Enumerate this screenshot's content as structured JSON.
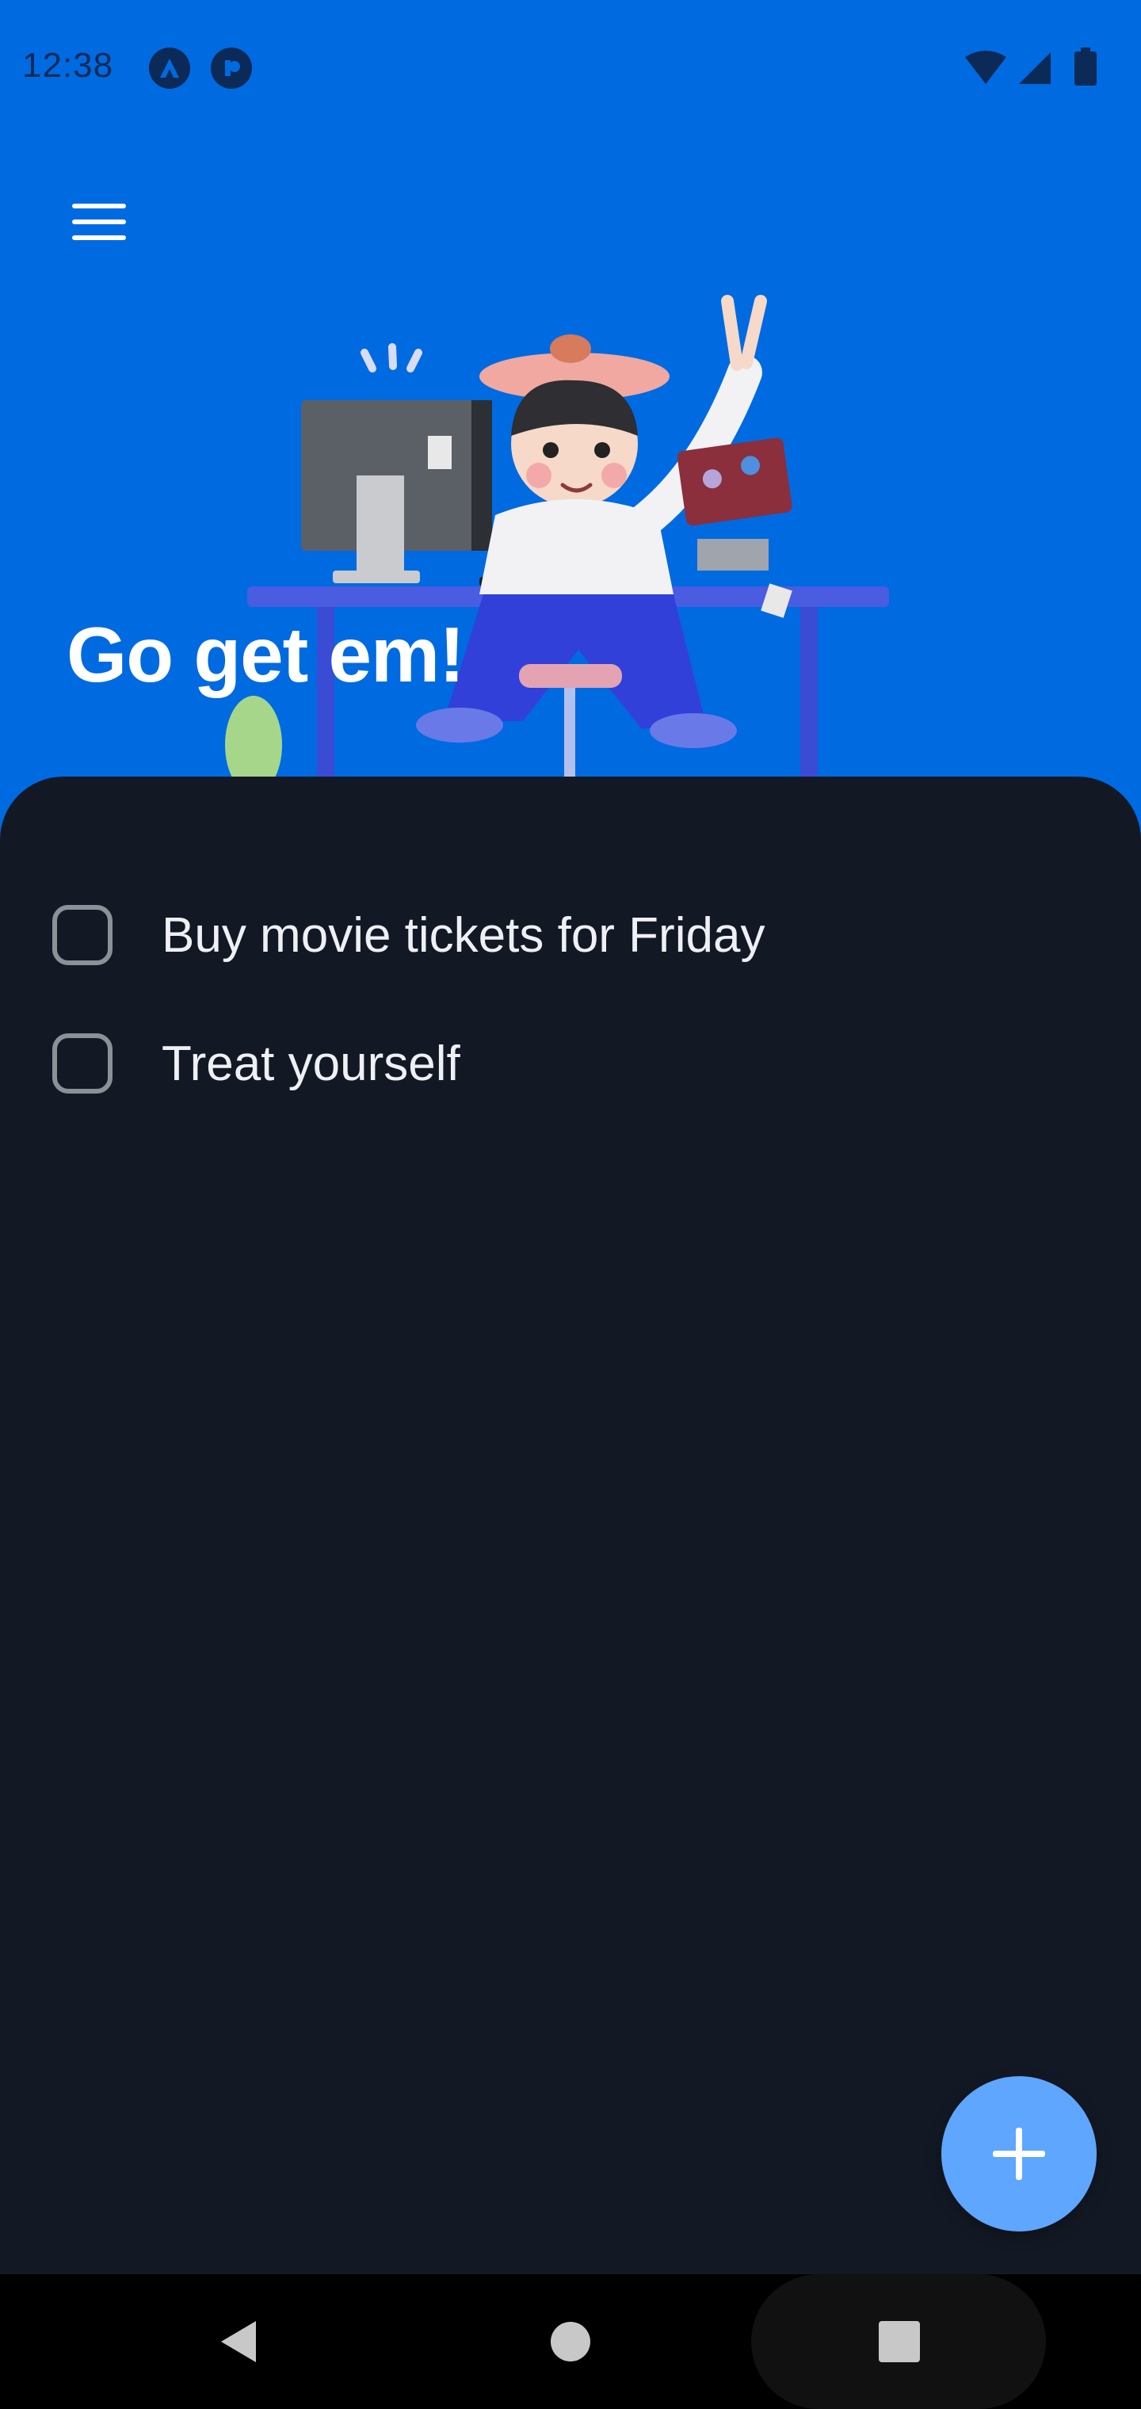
{
  "status_bar": {
    "time": "12:38",
    "app_icons": [
      "vpn-icon",
      "notification-app-icon"
    ],
    "indicators": [
      "wifi-icon",
      "cellular-signal-icon",
      "battery-icon"
    ]
  },
  "header": {
    "title": "Go get em!",
    "menu_icon": "hamburger-menu-icon",
    "background_color": "#006ae1"
  },
  "tasks": [
    {
      "label": "Buy movie tickets for Friday",
      "checked": false
    },
    {
      "label": "Treat yourself",
      "checked": false
    }
  ],
  "fab": {
    "icon": "plus-icon",
    "color": "#5ea6ff"
  },
  "nav_bar": {
    "buttons": [
      "back-icon",
      "home-icon",
      "recents-icon"
    ]
  }
}
